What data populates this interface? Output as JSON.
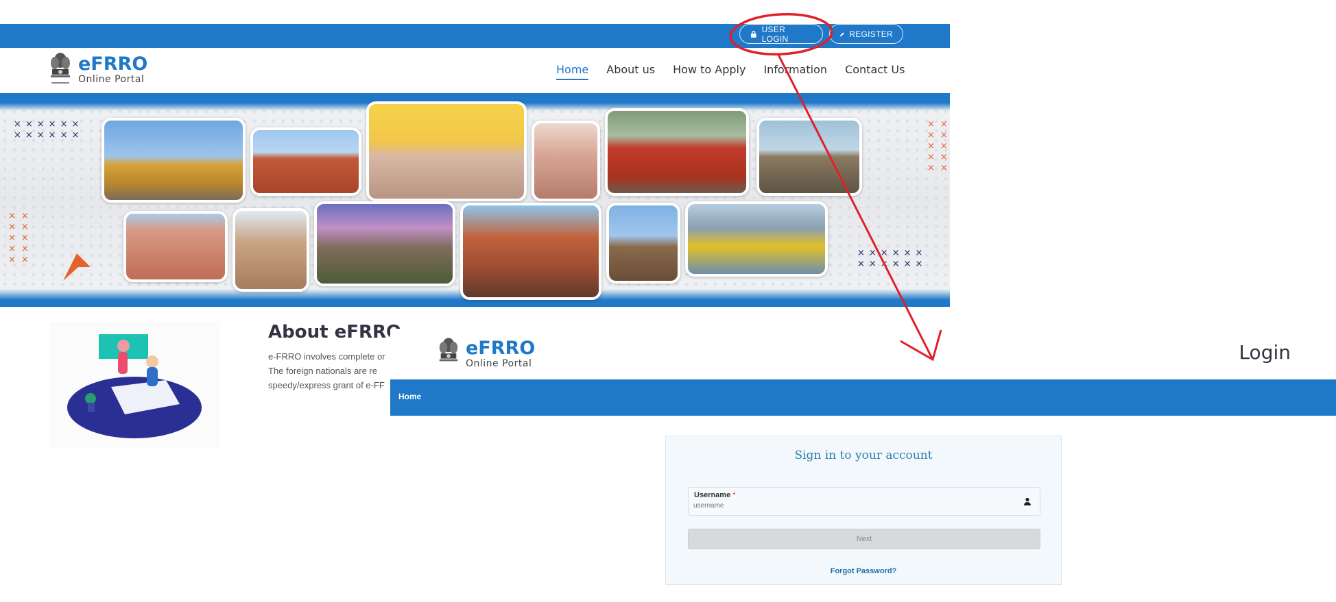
{
  "background_page": {
    "top_bar": {
      "user_login_label": "USER LOGIN",
      "register_label": "REGISTER",
      "lock_icon": "lock-icon",
      "pencil_icon": "pencil-icon"
    },
    "logo": {
      "title": "eFRRO",
      "subtitle": "Online Portal",
      "emblem_caption": "सत्यमेव जयते"
    },
    "nav": {
      "items": [
        "Home",
        "About us",
        "How to Apply",
        "Information",
        "Contact Us"
      ],
      "active": "Home"
    },
    "about": {
      "title": "About eFRRO",
      "lines": [
        "e-FRRO involves complete or",
        "The foreign nationals are re",
        "speedy/express grant of e-FF"
      ]
    }
  },
  "login_page": {
    "logo": {
      "title": "eFRRO",
      "subtitle": "Online Portal"
    },
    "heading": "Login",
    "breadcrumb": "Home",
    "card": {
      "title": "Sign in to your account",
      "username_label": "Username",
      "required_mark": "*",
      "username_placeholder": "username",
      "next_label": "Next",
      "forgot_label": "Forgot Password?"
    }
  },
  "colors": {
    "brand_blue": "#1f78c8",
    "annotation_red": "#e0202a",
    "accent_orange": "#e5622a"
  }
}
